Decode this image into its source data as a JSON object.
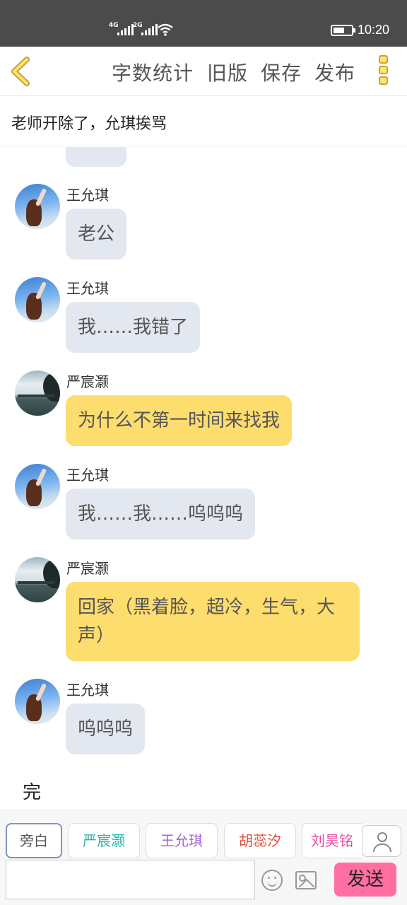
{
  "status_bar": {
    "signal1": "4G",
    "signal2": "2G",
    "time": "10:20"
  },
  "toolbar": {
    "word_count": "字数统计",
    "old_version": "旧版",
    "save": "保存",
    "publish": "发布"
  },
  "story_title": "老师开除了，允琪挨骂",
  "partial_bubble_text": "呜呜",
  "messages": [
    {
      "speaker": "王允琪",
      "text": "老公",
      "color": "#e3e7ef"
    },
    {
      "speaker": "王允琪",
      "text": "我……我错了",
      "color": "#e3e7ef"
    },
    {
      "speaker": "严宸灏",
      "text": "为什么不第一时间来找我",
      "color": "#fedd6f"
    },
    {
      "speaker": "王允琪",
      "text": "我……我……呜呜呜",
      "color": "#e3e7ef"
    },
    {
      "speaker": "严宸灏",
      "text": "回家（黑着脸，超冷，生气，大声）",
      "color": "#fedd6f"
    },
    {
      "speaker": "王允琪",
      "text": "呜呜呜",
      "color": "#e3e7ef"
    }
  ],
  "end_text": "完",
  "characters": [
    {
      "label": "旁白",
      "color": "#555555"
    },
    {
      "label": "严宸灏",
      "color": "#27b5a8"
    },
    {
      "label": "王允琪",
      "color": "#a565d6"
    },
    {
      "label": "胡蕊汐",
      "color": "#e0503a"
    },
    {
      "label": "刘昊铭",
      "color": "#e84e9e"
    }
  ],
  "input": {
    "value": "",
    "placeholder": ""
  },
  "send_label": "发送",
  "icons": {
    "back": "back-arrow-icon",
    "more": "more-icon",
    "emoji": "emoji-icon",
    "image": "image-icon",
    "person": "person-icon"
  }
}
